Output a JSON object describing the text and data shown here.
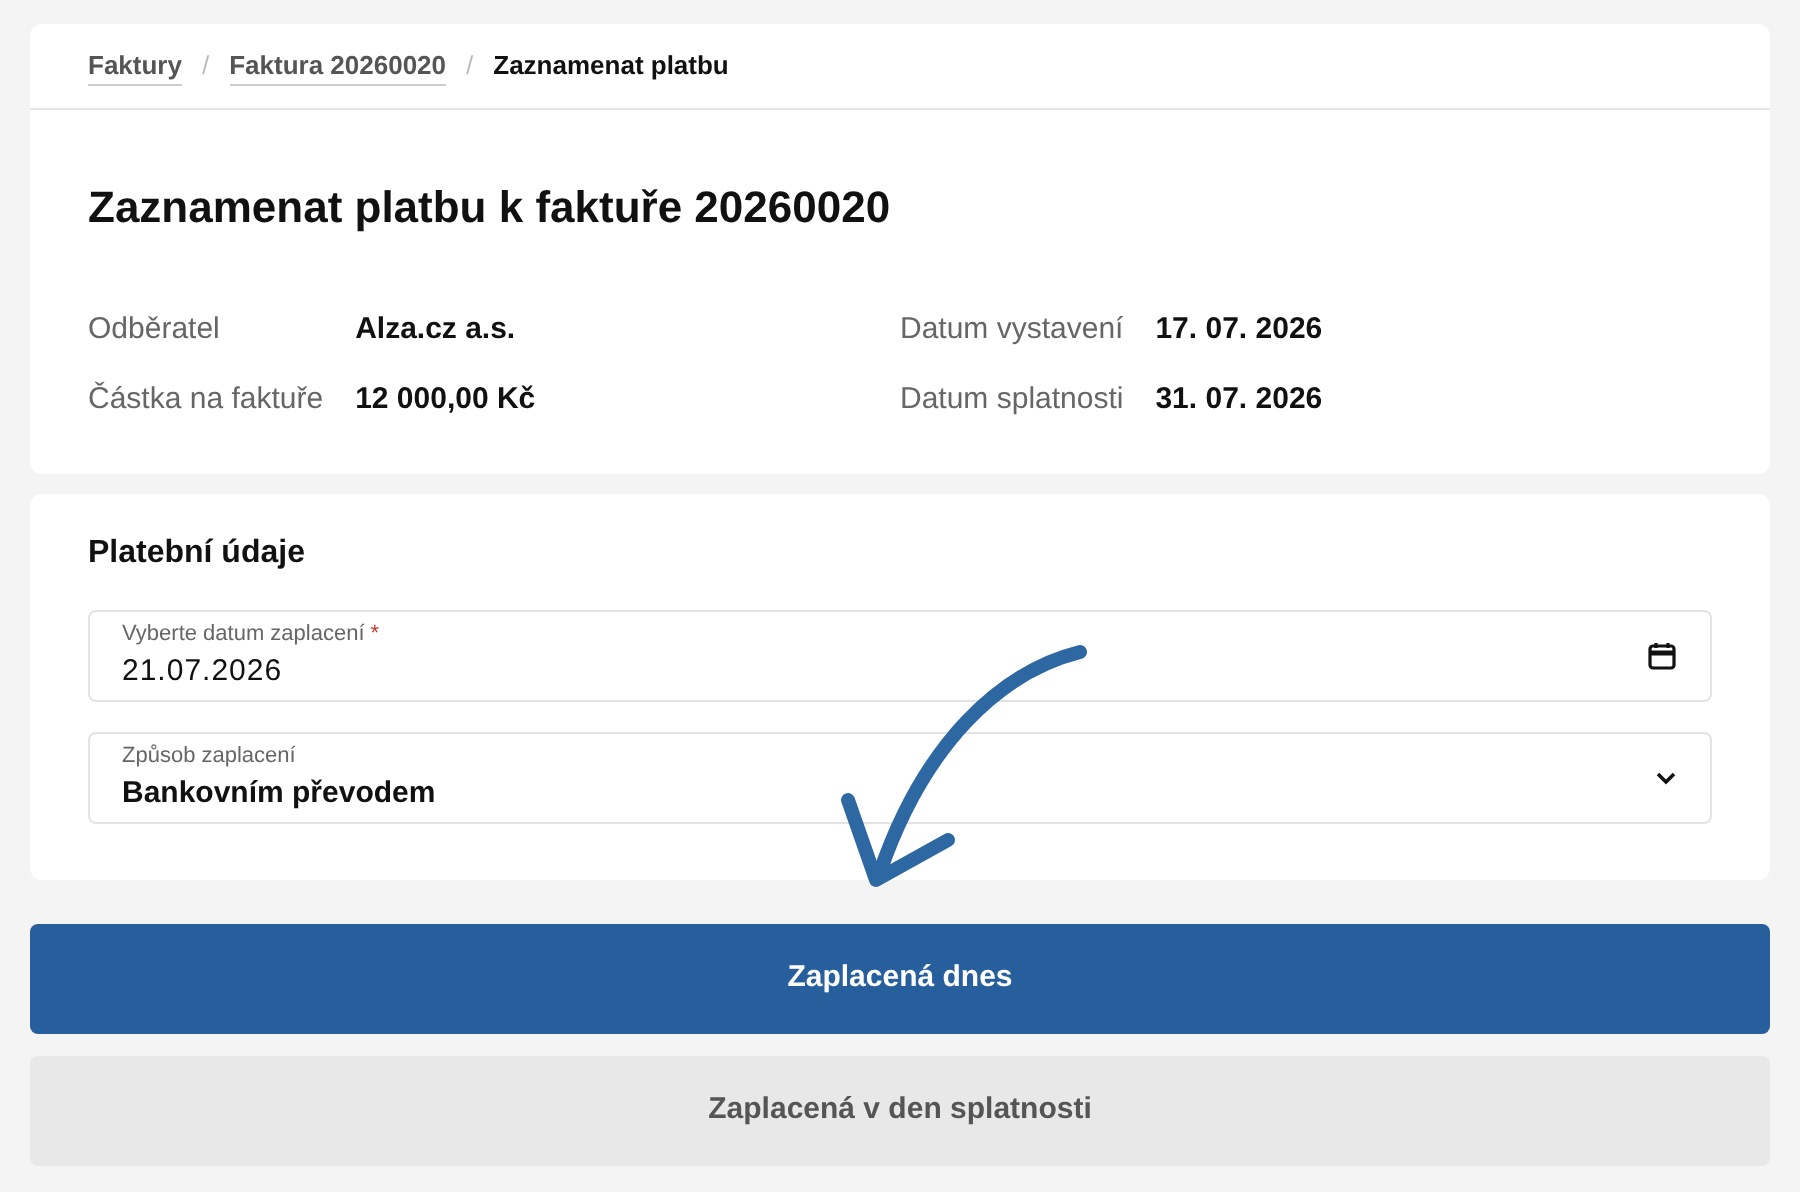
{
  "breadcrumb_separator": "/",
  "breadcrumb": [
    {
      "label": "Faktury",
      "current": false
    },
    {
      "label": "Faktura 20260020",
      "current": false
    },
    {
      "label": "Zaznamenat platbu",
      "current": true
    }
  ],
  "title": "Zaznamenat platbu k faktuře 20260020",
  "details": {
    "left": [
      {
        "label": "Odběratel",
        "value": "Alza.cz a.s."
      },
      {
        "label": "Částka na faktuře",
        "value": "12 000,00 Kč"
      }
    ],
    "right": [
      {
        "label": "Datum vystavení",
        "value": "17. 07. 2026"
      },
      {
        "label": "Datum splatnosti",
        "value": "31. 07. 2026"
      }
    ]
  },
  "payment": {
    "heading": "Platební údaje",
    "fields": [
      {
        "kind": "date",
        "label": "Vyberte datum zaplacení",
        "required_mark": "*",
        "value": "21.07.2026"
      },
      {
        "kind": "select",
        "label": "Způsob zaplacení",
        "value": "Bankovním převodem"
      }
    ]
  },
  "buttons": [
    {
      "kind": "primary",
      "label": "Zaplacená dnes"
    },
    {
      "kind": "secondary",
      "label": "Zaplacená v den splatnosti"
    }
  ]
}
